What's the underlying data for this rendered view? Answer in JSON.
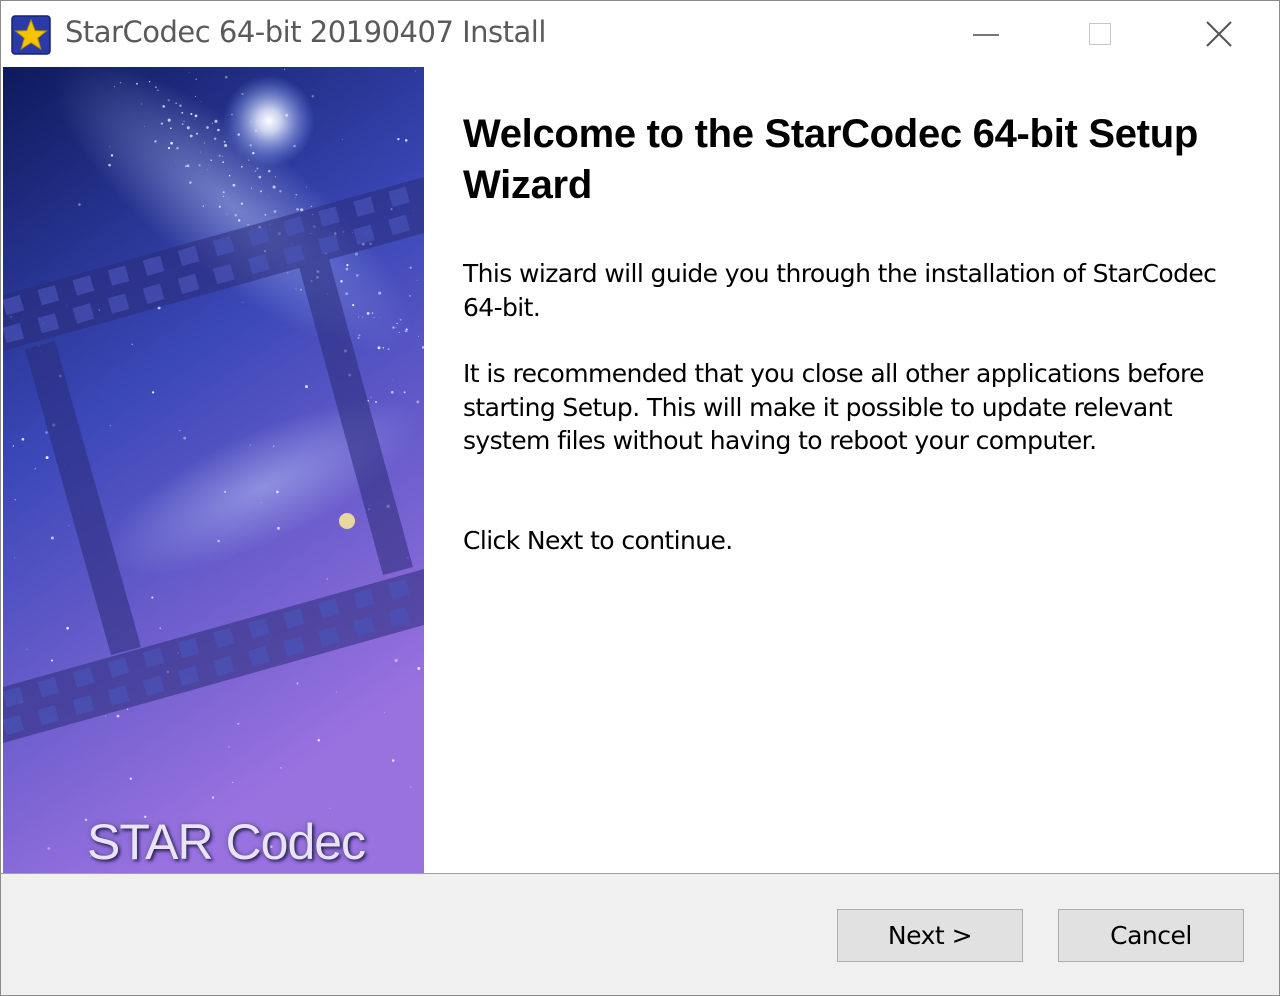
{
  "window": {
    "title": "StarCodec 64-bit 20190407 Install",
    "app_icon": "star-icon",
    "controls": {
      "minimize_icon": "minimize-icon",
      "maximize_icon": "maximize-icon",
      "close_icon": "close-icon"
    }
  },
  "banner": {
    "logo_text": "STAR Codec",
    "colors": {
      "top": "#0d1a5c",
      "middle": "#3b48b8",
      "bottom": "#9a72e0"
    }
  },
  "content": {
    "title": "Welcome to the StarCodec 64-bit Setup Wizard",
    "paragraphs": [
      "This wizard will guide you through the installation of StarCodec 64-bit.",
      "It is recommended that you close all other applications before starting Setup. This will make it possible to update relevant system files without having to reboot your computer.",
      "Click Next to continue."
    ]
  },
  "footer": {
    "next_label": "Next >",
    "cancel_label": "Cancel"
  }
}
